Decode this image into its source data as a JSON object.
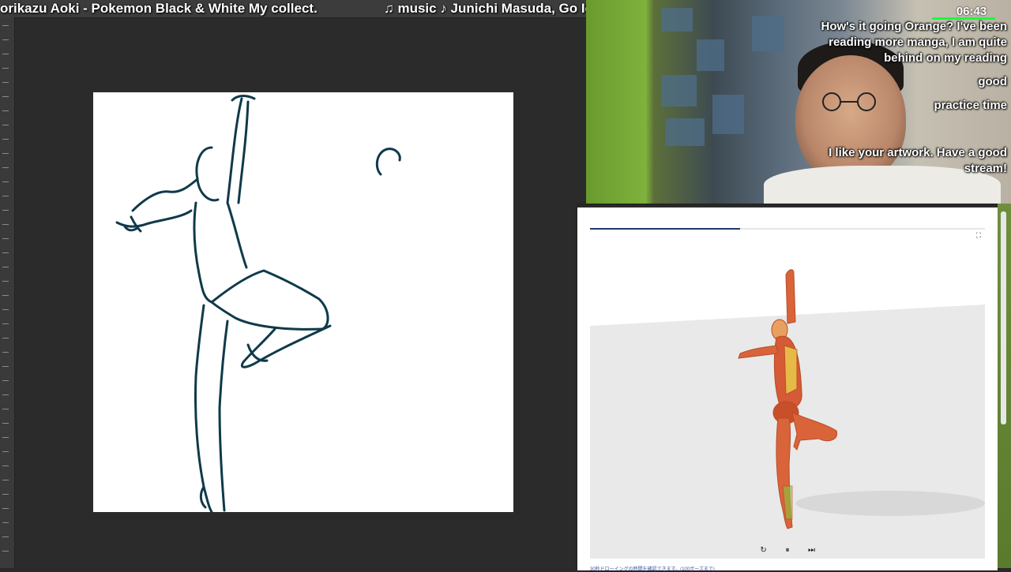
{
  "overlay": {
    "song_title": "orikazu Aoki - Pokemon Black & White My collect.",
    "music_credit": "♫ music ♪ Junichi Masuda, Go Ichinose, M",
    "timer": "06:43"
  },
  "chat": {
    "messages": [
      "How's it going Orange? I've been reading more manga, I am quite behind on my reading",
      "good",
      "practice time",
      "I like your artwork. Have a good stream!"
    ]
  },
  "reference_panel": {
    "progress": 0.38,
    "controls": {
      "restart_icon": "↻",
      "pause_icon": "⏸",
      "skip_icon": "⏭"
    },
    "footnote": "30秒ドローイングの時間を確認できます。(100ポーズまで)",
    "fullscreen_icon": "⛶"
  },
  "colors": {
    "ink": "#0f3a4a",
    "timer_bar": "#17ff3a",
    "progress": "#1e3b6a"
  }
}
